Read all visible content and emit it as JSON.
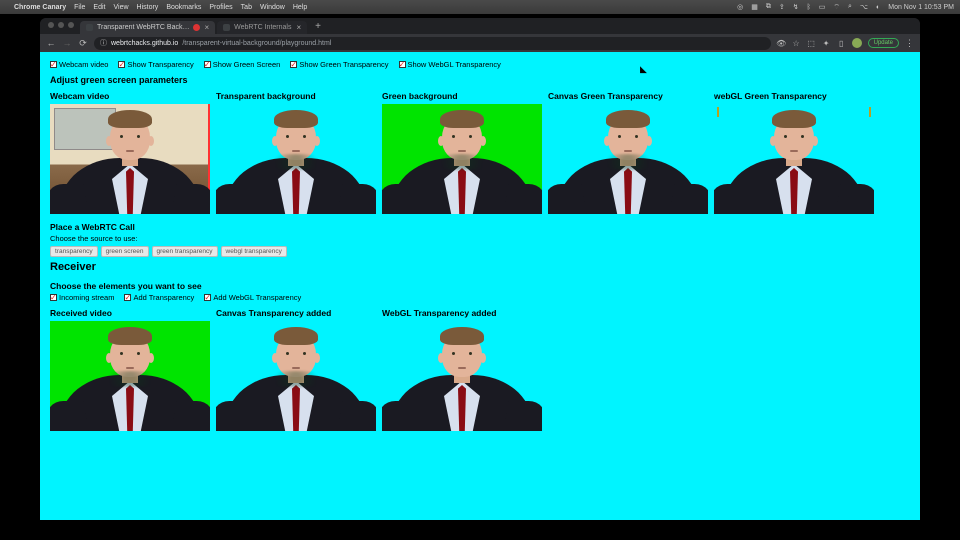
{
  "menubar": {
    "app": "Chrome Canary",
    "items": [
      "File",
      "Edit",
      "View",
      "History",
      "Bookmarks",
      "Profiles",
      "Tab",
      "Window",
      "Help"
    ],
    "clock": "Mon Nov 1  10:53 PM"
  },
  "tabs": {
    "active": "Transparent WebRTC Back…",
    "second": "WebRTC Internals"
  },
  "url": {
    "host": "webrtchacks.github.io",
    "path": "/transparent-virtual-background/playground.html"
  },
  "update_label": "Update",
  "checks_top": [
    "Webcam video",
    "Show Transparency",
    "Show Green Screen",
    "Show Green Transparency",
    "Show WebGL Transparency"
  ],
  "adjust_heading": "Adjust green screen parameters",
  "cols_top": [
    "Webcam video",
    "Transparent background",
    "Green background",
    "Canvas Green Transparency",
    "webGL Green Transparency"
  ],
  "call_heading": "Place a WebRTC Call",
  "choose_source": "Choose the source to use:",
  "source_buttons": [
    "transparency",
    "green screen",
    "green transparency",
    "webgl transparency"
  ],
  "receiver_heading": "Receiver",
  "choose_elements": "Choose the elements you want to see",
  "checks_bottom": [
    "Incoming stream",
    "Add Transparency",
    "Add WebGL Transparency"
  ],
  "cols_bottom": [
    "Received video",
    "Canvas Transparency added",
    "WebGL Transparency added"
  ]
}
